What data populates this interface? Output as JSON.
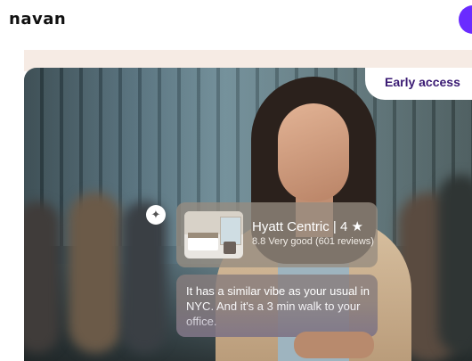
{
  "header": {
    "logo_text": "navan"
  },
  "hero": {
    "badge_label": "Early access",
    "sparkle_icon": "sparkle-icon"
  },
  "hotel_card": {
    "name": "Hyatt Centric",
    "separator": "|",
    "rating": "4",
    "star_icon": "★",
    "review_summary": "8.8 Very good (601 reviews)"
  },
  "assistant_message": {
    "text": "It has a similar vibe as your usual in NYC. And it's a 3 min walk to your office."
  },
  "colors": {
    "brand_purple": "#6a2bff",
    "badge_text": "#3a1a73",
    "band": "#f6ebe4"
  }
}
